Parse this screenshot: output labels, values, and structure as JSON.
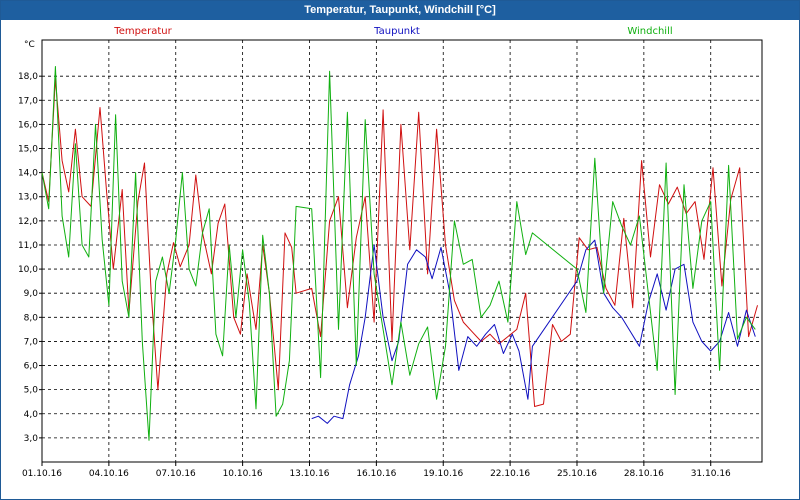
{
  "window": {
    "title": "Temperatur, Taupunkt, Windchill [°C]"
  },
  "chart_data": {
    "type": "line",
    "unit_label": "°C",
    "ylim": [
      2.0,
      19.5
    ],
    "yticks": [
      3.0,
      4.0,
      5.0,
      6.0,
      7.0,
      8.0,
      9.0,
      10.0,
      11.0,
      12.0,
      13.0,
      14.0,
      15.0,
      16.0,
      17.0,
      18.0
    ],
    "ytick_labels": [
      "3,0",
      "4,0",
      "5,0",
      "6,0",
      "7,0",
      "8,0",
      "9,0",
      "10,0",
      "11,0",
      "12,0",
      "13,0",
      "14,0",
      "15,0",
      "16,0",
      "17,0",
      "18,0"
    ],
    "xlim": [
      1.0,
      33.3
    ],
    "xticks": [
      1,
      4,
      7,
      10,
      13,
      16,
      19,
      22,
      25,
      28,
      31
    ],
    "xtick_labels": [
      "01.10.16",
      "04.10.16",
      "07.10.16",
      "10.10.16",
      "13.10.16",
      "16.10.16",
      "19.10.16",
      "22.10.16",
      "25.10.16",
      "28.10.16",
      "31.10.16"
    ],
    "grid": true,
    "legend_position": "top",
    "series": [
      {
        "name": "Temperatur",
        "color": "#d01010",
        "x": [
          1.0,
          1.3,
          1.6,
          1.9,
          2.2,
          2.5,
          2.8,
          3.2,
          3.6,
          3.9,
          4.2,
          4.6,
          4.9,
          5.3,
          5.6,
          5.9,
          6.2,
          6.6,
          6.9,
          7.2,
          7.6,
          7.9,
          8.2,
          8.6,
          8.9,
          9.2,
          9.6,
          9.9,
          10.2,
          10.6,
          10.9,
          11.2,
          11.6,
          11.9,
          12.2,
          12.4,
          13.1,
          13.5,
          13.9,
          14.3,
          14.7,
          15.1,
          15.5,
          15.9,
          16.3,
          16.7,
          17.1,
          17.5,
          17.9,
          18.3,
          18.7,
          19.1,
          19.5,
          19.9,
          20.3,
          20.7,
          21.1,
          21.5,
          21.9,
          22.3,
          22.7,
          23.1,
          23.5,
          23.9,
          24.3,
          24.7,
          25.1,
          25.5,
          25.9,
          26.3,
          26.7,
          27.1,
          27.5,
          27.9,
          28.3,
          28.7,
          29.1,
          29.5,
          29.9,
          30.3,
          30.7,
          31.1,
          31.5,
          31.9,
          32.3,
          32.7,
          33.1
        ],
        "y": [
          14.0,
          12.8,
          17.9,
          14.5,
          13.2,
          15.8,
          13.0,
          12.6,
          16.7,
          13.2,
          10.0,
          13.3,
          8.2,
          12.8,
          14.4,
          9.0,
          5.0,
          9.8,
          11.1,
          10.1,
          11.0,
          13.9,
          11.5,
          9.8,
          11.9,
          12.7,
          8.0,
          7.3,
          9.8,
          7.5,
          11.0,
          9.0,
          5.0,
          11.5,
          10.9,
          9.0,
          9.2,
          7.2,
          12.0,
          13.0,
          8.4,
          11.3,
          13.0,
          7.8,
          16.6,
          7.0,
          16.0,
          10.8,
          16.5,
          9.8,
          15.8,
          11.0,
          8.7,
          7.8,
          7.4,
          7.0,
          7.3,
          6.9,
          7.2,
          7.5,
          9.0,
          4.3,
          4.4,
          7.7,
          7.0,
          7.3,
          11.3,
          10.8,
          10.9,
          9.2,
          8.5,
          12.1,
          8.4,
          14.5,
          10.5,
          13.5,
          12.7,
          13.4,
          12.3,
          12.8,
          10.4,
          14.2,
          9.3,
          12.9,
          14.2,
          7.2,
          8.5
        ]
      },
      {
        "name": "Taupunkt",
        "color": "#1010c0",
        "x": [
          13.1,
          13.4,
          13.8,
          14.1,
          14.5,
          14.8,
          15.2,
          15.5,
          15.9,
          16.3,
          16.7,
          17.0,
          17.4,
          17.8,
          18.2,
          18.5,
          18.9,
          19.3,
          19.7,
          20.1,
          20.5,
          20.9,
          21.3,
          21.7,
          22.1,
          22.4,
          22.8,
          23.0,
          25.0,
          25.4,
          25.8,
          26.2,
          26.6,
          27.0,
          27.4,
          27.8,
          28.2,
          28.6,
          29.0,
          29.4,
          29.8,
          30.2,
          30.6,
          31.0,
          31.4,
          31.8,
          32.2,
          32.6,
          33.0
        ],
        "y": [
          3.8,
          3.9,
          3.6,
          3.9,
          3.8,
          5.2,
          6.4,
          8.0,
          11.0,
          8.0,
          6.2,
          7.0,
          10.2,
          10.8,
          10.5,
          9.6,
          10.9,
          9.0,
          5.8,
          7.2,
          6.8,
          7.3,
          7.7,
          6.5,
          7.3,
          6.6,
          4.6,
          6.8,
          9.5,
          10.8,
          11.2,
          9.0,
          8.4,
          8.0,
          7.4,
          6.8,
          8.6,
          9.8,
          8.3,
          10.0,
          10.2,
          7.8,
          7.0,
          6.6,
          7.0,
          8.2,
          6.8,
          8.3,
          7.2
        ]
      },
      {
        "name": "Windchill",
        "color": "#10b010",
        "x": [
          1.0,
          1.3,
          1.6,
          1.9,
          2.2,
          2.5,
          2.8,
          3.1,
          3.4,
          3.7,
          4.0,
          4.3,
          4.6,
          4.9,
          5.2,
          5.5,
          5.8,
          6.1,
          6.4,
          6.7,
          7.0,
          7.3,
          7.6,
          7.9,
          8.2,
          8.5,
          8.8,
          9.1,
          9.4,
          9.7,
          10.0,
          10.3,
          10.6,
          10.9,
          11.2,
          11.5,
          11.8,
          12.1,
          12.4,
          13.1,
          13.5,
          13.9,
          14.3,
          14.7,
          15.1,
          15.5,
          15.9,
          16.3,
          16.7,
          17.1,
          17.5,
          17.9,
          18.3,
          18.7,
          19.1,
          19.5,
          19.9,
          20.3,
          20.7,
          21.1,
          21.5,
          21.9,
          22.3,
          22.7,
          23.0,
          25.0,
          25.4,
          25.8,
          26.2,
          26.6,
          27.0,
          27.4,
          27.8,
          28.2,
          28.6,
          29.0,
          29.4,
          29.8,
          30.2,
          30.6,
          31.0,
          31.4,
          31.8,
          32.2,
          32.6,
          33.0
        ],
        "y": [
          14.0,
          12.5,
          18.4,
          12.2,
          10.5,
          15.2,
          11.0,
          10.5,
          16.0,
          11.2,
          8.5,
          16.4,
          9.5,
          8.0,
          14.0,
          7.0,
          2.9,
          9.5,
          10.5,
          9.0,
          11.2,
          14.0,
          10.0,
          9.3,
          11.5,
          12.5,
          7.3,
          6.4,
          11.0,
          8.0,
          10.8,
          8.6,
          4.2,
          11.4,
          9.0,
          3.9,
          4.4,
          6.2,
          12.6,
          12.5,
          5.5,
          18.2,
          7.5,
          16.5,
          6.0,
          16.2,
          9.8,
          7.5,
          5.2,
          7.8,
          5.6,
          6.9,
          7.6,
          4.6,
          6.8,
          12.0,
          10.2,
          10.4,
          8.0,
          8.5,
          9.5,
          7.8,
          12.8,
          10.6,
          11.5,
          10.0,
          8.2,
          14.6,
          9.0,
          12.8,
          11.8,
          11.0,
          12.2,
          9.0,
          5.8,
          14.4,
          4.8,
          13.5,
          9.2,
          12.0,
          12.8,
          5.8,
          14.3,
          7.1,
          8.0,
          7.5
        ]
      }
    ]
  }
}
